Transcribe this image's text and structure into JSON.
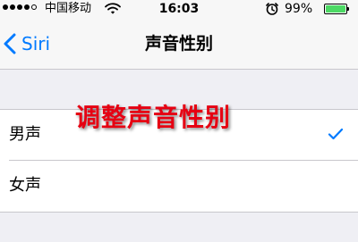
{
  "status_bar": {
    "carrier": "中国移动",
    "time": "16:03",
    "battery_percent": "99%",
    "signal_bars_filled": 4,
    "signal_bars_total": 5,
    "battery_level": 0.99,
    "battery_color": "#4cd964",
    "icons": [
      "wifi-icon",
      "alarm-icon",
      "battery-icon"
    ]
  },
  "nav": {
    "back_label": "Siri",
    "title": "声音性别",
    "accent_color": "#007aff"
  },
  "options": [
    {
      "label": "男声",
      "selected": true
    },
    {
      "label": "女声",
      "selected": false
    }
  ],
  "overlay_caption": "调整声音性别"
}
